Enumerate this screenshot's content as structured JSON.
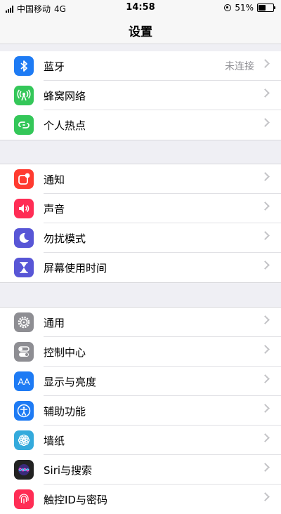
{
  "status_bar": {
    "carrier": "中国移动",
    "network": "4G",
    "time": "14:58",
    "battery_text": "51%",
    "battery_level": 0.51
  },
  "header": {
    "title": "设置"
  },
  "groups": [
    {
      "items": [
        {
          "label": "蓝牙",
          "value": "未连接",
          "icon": "bluetooth-icon",
          "color": "#1e7bf4"
        },
        {
          "label": "蜂窝网络",
          "value": "",
          "icon": "cellular-icon",
          "color": "#34c759"
        },
        {
          "label": "个人热点",
          "value": "",
          "icon": "hotspot-icon",
          "color": "#34c759"
        }
      ]
    },
    {
      "items": [
        {
          "label": "通知",
          "icon": "notification-icon",
          "color": "#ff3b30"
        },
        {
          "label": "声音",
          "icon": "sound-icon",
          "color": "#ff2d55"
        },
        {
          "label": "勿扰模式",
          "icon": "moon-icon",
          "color": "#5856d6"
        },
        {
          "label": "屏幕使用时间",
          "icon": "hourglass-icon",
          "color": "#5856d6"
        }
      ]
    },
    {
      "items": [
        {
          "label": "通用",
          "icon": "gear-icon",
          "color": "#8e8e93"
        },
        {
          "label": "控制中心",
          "icon": "control-center-icon",
          "color": "#8e8e93"
        },
        {
          "label": "显示与亮度",
          "icon": "display-icon",
          "color": "#1e7bf4"
        },
        {
          "label": "辅助功能",
          "icon": "accessibility-icon",
          "color": "#1e7bf4"
        },
        {
          "label": "墙纸",
          "icon": "wallpaper-icon",
          "color": "#34aadc"
        },
        {
          "label": "Siri与搜索",
          "icon": "siri-icon",
          "color": "#222222"
        },
        {
          "label": "触控ID与密码",
          "icon": "touch-id-icon",
          "color": "#ff2d55"
        }
      ]
    }
  ]
}
